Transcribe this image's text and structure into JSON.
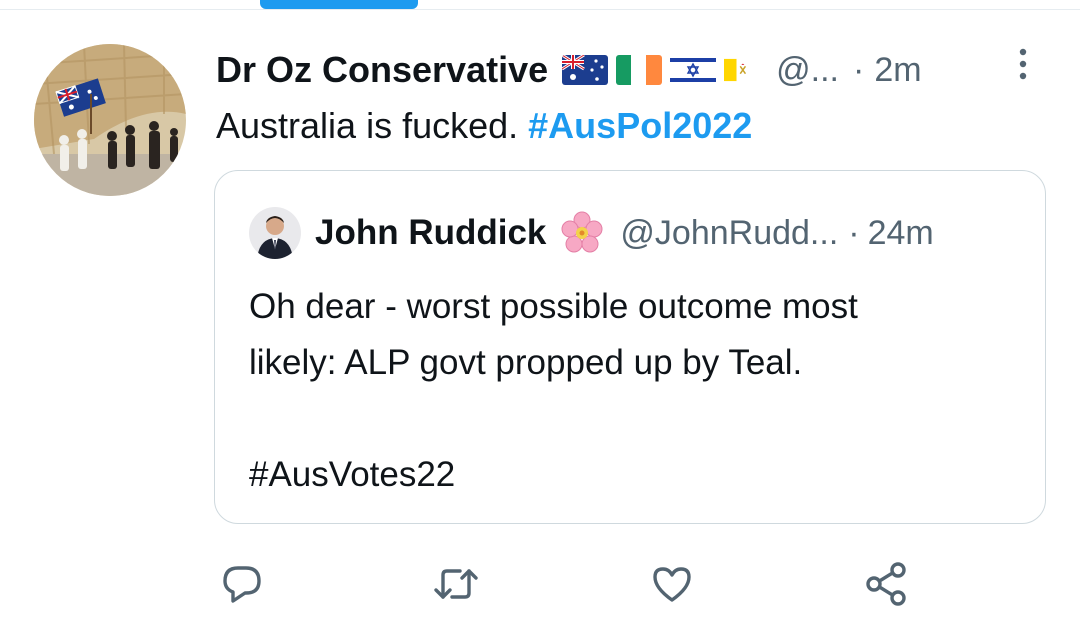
{
  "tweet": {
    "author": {
      "display_name": "Dr Oz Conservative",
      "handle": "@...",
      "flags": [
        "australia-flag",
        "ireland-flag",
        "israel-flag",
        "vatican-flag"
      ]
    },
    "separator": "·",
    "time": "2m",
    "text_plain": "Australia is fucked.",
    "hashtag": "#AusPol2022"
  },
  "quoted_tweet": {
    "display_name": "John Ruddick",
    "emoji": "cherry-blossom-icon",
    "handle": "@JohnRudd...",
    "separator": "·",
    "time": "24m",
    "lines": [
      "Oh dear - worst possible outcome most",
      "likely: ALP govt propped up by Teal.",
      "",
      "#AusVotes22"
    ]
  },
  "actions": [
    "reply-icon",
    "retweet-icon",
    "like-icon",
    "share-icon"
  ],
  "colors": {
    "accent": "#1d9bf0",
    "text": "#0f1419",
    "secondary": "#536471",
    "border": "#cfd9de"
  }
}
